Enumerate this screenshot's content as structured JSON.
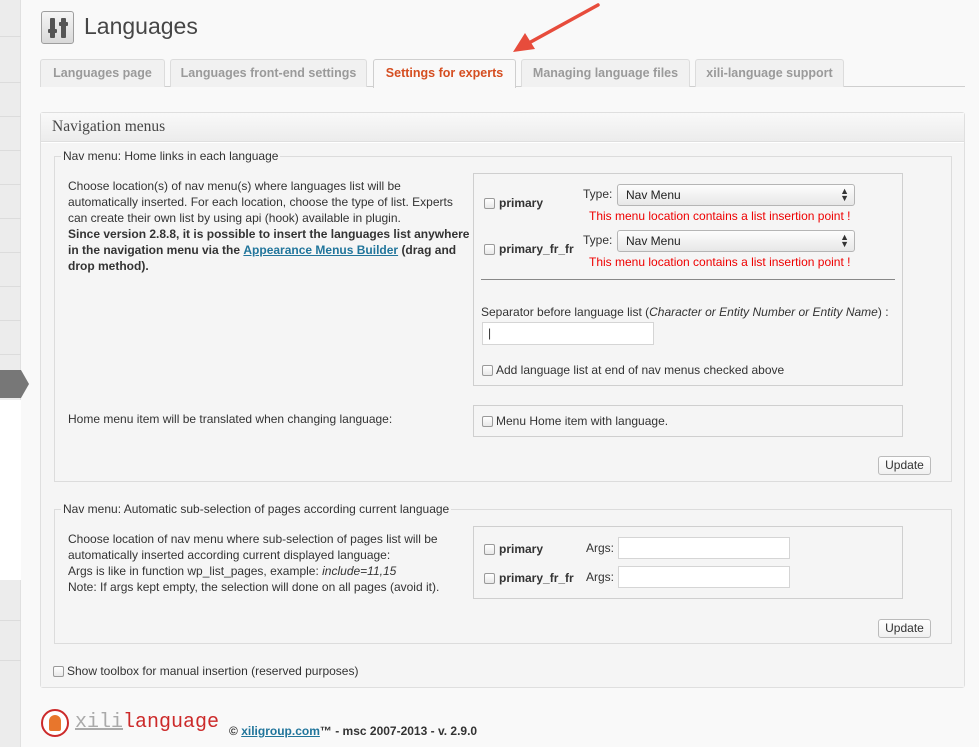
{
  "header": {
    "title": "Languages",
    "icon": "settings-sliders-icon"
  },
  "annotation": {
    "arrow_color": "#e74c3c"
  },
  "tabs": [
    {
      "label": "Languages page",
      "active": false
    },
    {
      "label": "Languages front-end settings",
      "active": false
    },
    {
      "label": "Settings for experts",
      "active": true
    },
    {
      "label": "Managing language files",
      "active": false
    },
    {
      "label": "xili-language support",
      "active": false
    }
  ],
  "colors": {
    "active_tab": "#d54e21",
    "warning": "#e00000",
    "link": "#21759b"
  },
  "box": {
    "title": "Navigation menus",
    "fieldset1": {
      "legend": "Nav menu: Home links in each language",
      "desc_line1": "Choose location(s) of nav menu(s) where languages list will be",
      "desc_line2": "automatically inserted. For each location, choose the type of list. Experts",
      "desc_line3": "can create their own list by using api (hook) available in plugin.",
      "desc_bold_line4": "Since version 2.8.8, it is possible to insert the languages list anywhere",
      "desc_bold_line5a": "in the navigation menu via the",
      "desc_link": "Appearance Menus Builder",
      "desc_bold_line5b": "(drag and",
      "desc_bold_line6": "drop method).",
      "locations": [
        {
          "name": "primary",
          "type_label": "Type:",
          "type_value": "Nav Menu",
          "warning": "This menu location contains a list insertion point !"
        },
        {
          "name": "primary_fr_fr",
          "type_label": "Type:",
          "type_value": "Nav Menu",
          "warning": "This menu location contains a list insertion point !"
        }
      ],
      "separator_label": "Separator before language list (",
      "separator_italic": "Character or Entity Number or Entity Name",
      "separator_suffix": ") :",
      "separator_value": "|",
      "add_list_label": "Add language list at end of nav menus checked above",
      "home_desc": "Home menu item will be translated when changing language:",
      "home_checkbox_label": "Menu Home item with language.",
      "update_label": "Update"
    },
    "fieldset2": {
      "legend": "Nav menu: Automatic sub-selection of pages according current language",
      "desc_line1": "Choose location of nav menu where sub-selection of pages list will be",
      "desc_line2": "automatically inserted according current displayed language:",
      "desc_line3a": "Args is like in function wp_list_pages, example: ",
      "desc_line3_italic": "include=11,15",
      "desc_line4": "Note: If args kept empty, the selection will done on all pages (avoid it).",
      "locations": [
        {
          "name": "primary",
          "args_label": "Args:",
          "args_value": ""
        },
        {
          "name": "primary_fr_fr",
          "args_label": "Args:",
          "args_value": ""
        }
      ],
      "update_label": "Update"
    },
    "toolbox_label": "Show toolbox for manual insertion (reserved purposes)"
  },
  "footer": {
    "brand_part1": "xili",
    "brand_part2": "language",
    "copyright": "©",
    "site_link": "xiligroup.com",
    "credit_suffix": "™ - msc 2007-2013 - v. 2.9.0",
    "logo_icon": "xili-logo-icon"
  }
}
